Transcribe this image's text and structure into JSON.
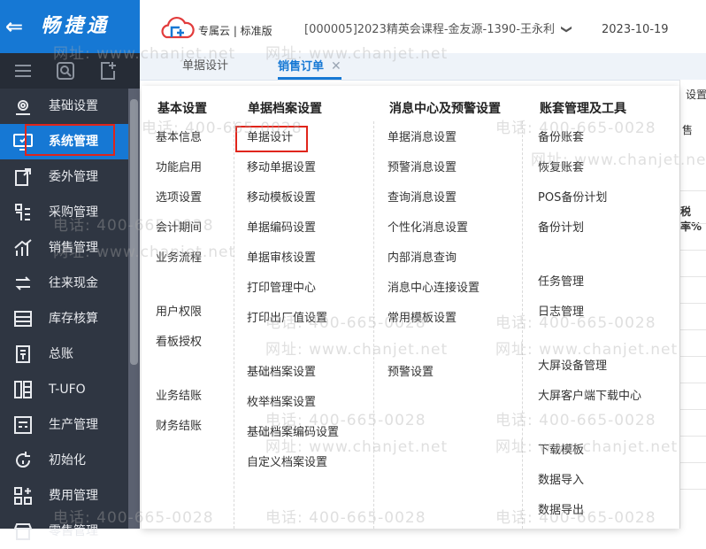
{
  "app": {
    "name": "畅捷通",
    "back_glyph": "⇐"
  },
  "header": {
    "product": "专属云 | 标准版",
    "account": "[000005]2023精英会课程-金友源-1390-王永利",
    "chevron": "❯",
    "date": "2023-10-19"
  },
  "tabs": [
    {
      "label": "单据设计",
      "active": false
    },
    {
      "label": "销售订单",
      "active": true,
      "close": "✕"
    }
  ],
  "sidebar": {
    "items": [
      {
        "label": "基础设置",
        "icon": "gear-box-icon"
      },
      {
        "label": "系统管理",
        "icon": "monitor-icon",
        "active": true
      },
      {
        "label": "委外管理",
        "icon": "document-out-icon"
      },
      {
        "label": "采购管理",
        "icon": "purchase-icon"
      },
      {
        "label": "销售管理",
        "icon": "chart-up-icon"
      },
      {
        "label": "往来现金",
        "icon": "exchange-icon"
      },
      {
        "label": "库存核算",
        "icon": "warehouse-icon"
      },
      {
        "label": "总账",
        "icon": "ledger-icon"
      },
      {
        "label": "T-UFO",
        "icon": "report-icon"
      },
      {
        "label": "生产管理",
        "icon": "production-icon"
      },
      {
        "label": "初始化",
        "icon": "init-icon"
      },
      {
        "label": "费用管理",
        "icon": "expense-icon"
      },
      {
        "label": "零售管理",
        "icon": "retail-icon"
      }
    ]
  },
  "menu": {
    "columns": [
      {
        "title": "基本设置",
        "items": [
          "基本信息",
          "功能启用",
          "选项设置",
          "会计期间",
          "业务流程",
          "用户权限",
          "看板授权",
          "业务结账",
          "财务结账"
        ]
      },
      {
        "title": "单据档案设置",
        "items": [
          "单据设计",
          "移动单据设置",
          "移动模板设置",
          "单据编码设置",
          "单据审核设置",
          "打印管理中心",
          "打印出厂值设置",
          "基础档案设置",
          "枚举档案设置",
          "基础档案编码设置",
          "自定义档案设置"
        ]
      },
      {
        "title": "消息中心及预警设置",
        "items": [
          "单据消息设置",
          "预警消息设置",
          "查询消息设置",
          "个性化消息设置",
          "内部消息查询",
          "消息中心连接设置",
          "常用模板设置",
          "预警设置"
        ]
      },
      {
        "title": "账套管理及工具",
        "items": [
          "备份账套",
          "恢复账套",
          "POS备份计划",
          "备份计划",
          "任务管理",
          "日志管理",
          "大屏设备管理",
          "大屏客户端下载中心",
          "下载模板",
          "数据导入",
          "数据导出"
        ]
      }
    ]
  },
  "background": {
    "frag1": "设置",
    "frag2": "售",
    "frag3": "税率%"
  },
  "watermark": {
    "phone": "电话: 400-665-0028",
    "site": "网址: www.chanjet.net"
  },
  "colors": {
    "primary": "#1678d4",
    "sidebar": "#2f3642",
    "highlight": "#e0251b"
  }
}
